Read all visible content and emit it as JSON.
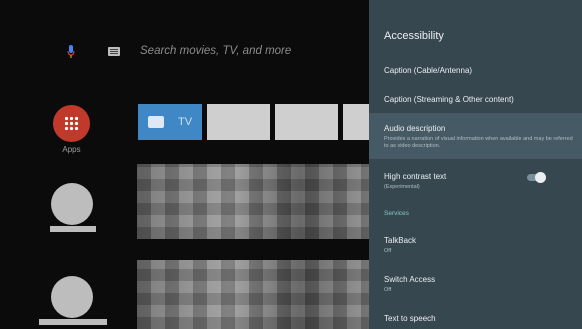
{
  "home": {
    "search_placeholder": "Search movies, TV, and more",
    "apps_label": "Apps",
    "tv_tile_label": "TV",
    "mic_color": "#4285f4",
    "apps_color": "#c0392b"
  },
  "accessibility": {
    "title": "Accessibility",
    "items": [
      {
        "label": "Caption (Cable/Antenna)",
        "sub": ""
      },
      {
        "label": "Caption (Streaming & Other content)",
        "sub": ""
      },
      {
        "label": "Audio description",
        "sub": "Provides a narration of visual information when available and may be referred to as video description."
      },
      {
        "label": "High contrast text",
        "sub": "(Experimental)",
        "toggle": "off"
      }
    ],
    "section_services": "Services",
    "services": [
      {
        "label": "TalkBack",
        "sub": "Off"
      },
      {
        "label": "Switch Access",
        "sub": "Off"
      },
      {
        "label": "Text to speech",
        "sub": ""
      }
    ],
    "panel_color": "#37474f",
    "focus_color": "#455a64",
    "section_color": "#80cbc4"
  }
}
